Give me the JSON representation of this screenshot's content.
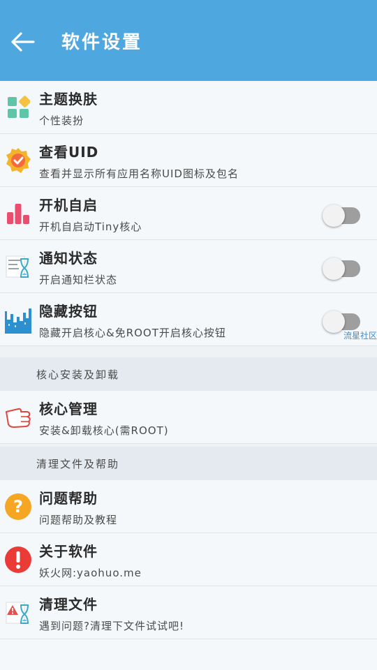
{
  "appbar": {
    "title": "软件设置",
    "back_icon": "arrow-left-icon"
  },
  "watermark": "流星社区",
  "colors": {
    "appbar": "#4ea8df",
    "toggle_track_off": "#9e9e9e"
  },
  "items": [
    {
      "title": "主题换肤",
      "subtitle": "个性装扮",
      "icon": "theme-grid-icon"
    },
    {
      "title": "查看UID",
      "subtitle": "查看并显示所有应用名称UID图标及包名",
      "icon": "verified-badge-icon"
    },
    {
      "title": "开机自启",
      "subtitle": "开机自启动Tiny核心",
      "icon": "bar-chart-icon",
      "toggle": false
    },
    {
      "title": "通知状态",
      "subtitle": "开启通知栏状态",
      "icon": "notification-hourglass-icon",
      "toggle": false
    },
    {
      "title": "隐藏按钮",
      "subtitle": "隐藏开启核心&免ROOT开启核心按钮",
      "icon": "city-skyline-icon",
      "toggle": false
    }
  ],
  "section_core": {
    "label": "核心安装及卸载"
  },
  "core_item": {
    "title": "核心管理",
    "subtitle": "安装&卸载核心(需ROOT)",
    "icon": "pointing-hand-icon"
  },
  "section_clean": {
    "label": "清理文件及帮助"
  },
  "help_items": [
    {
      "title": "问题帮助",
      "subtitle": "问题帮助及教程",
      "icon": "question-circle-icon"
    },
    {
      "title": "关于软件",
      "subtitle": "妖火网:yaohuo.me",
      "icon": "exclamation-circle-icon"
    },
    {
      "title": "清理文件",
      "subtitle": "遇到问题?清理下文件试试吧!",
      "icon": "warning-hourglass-icon"
    }
  ]
}
